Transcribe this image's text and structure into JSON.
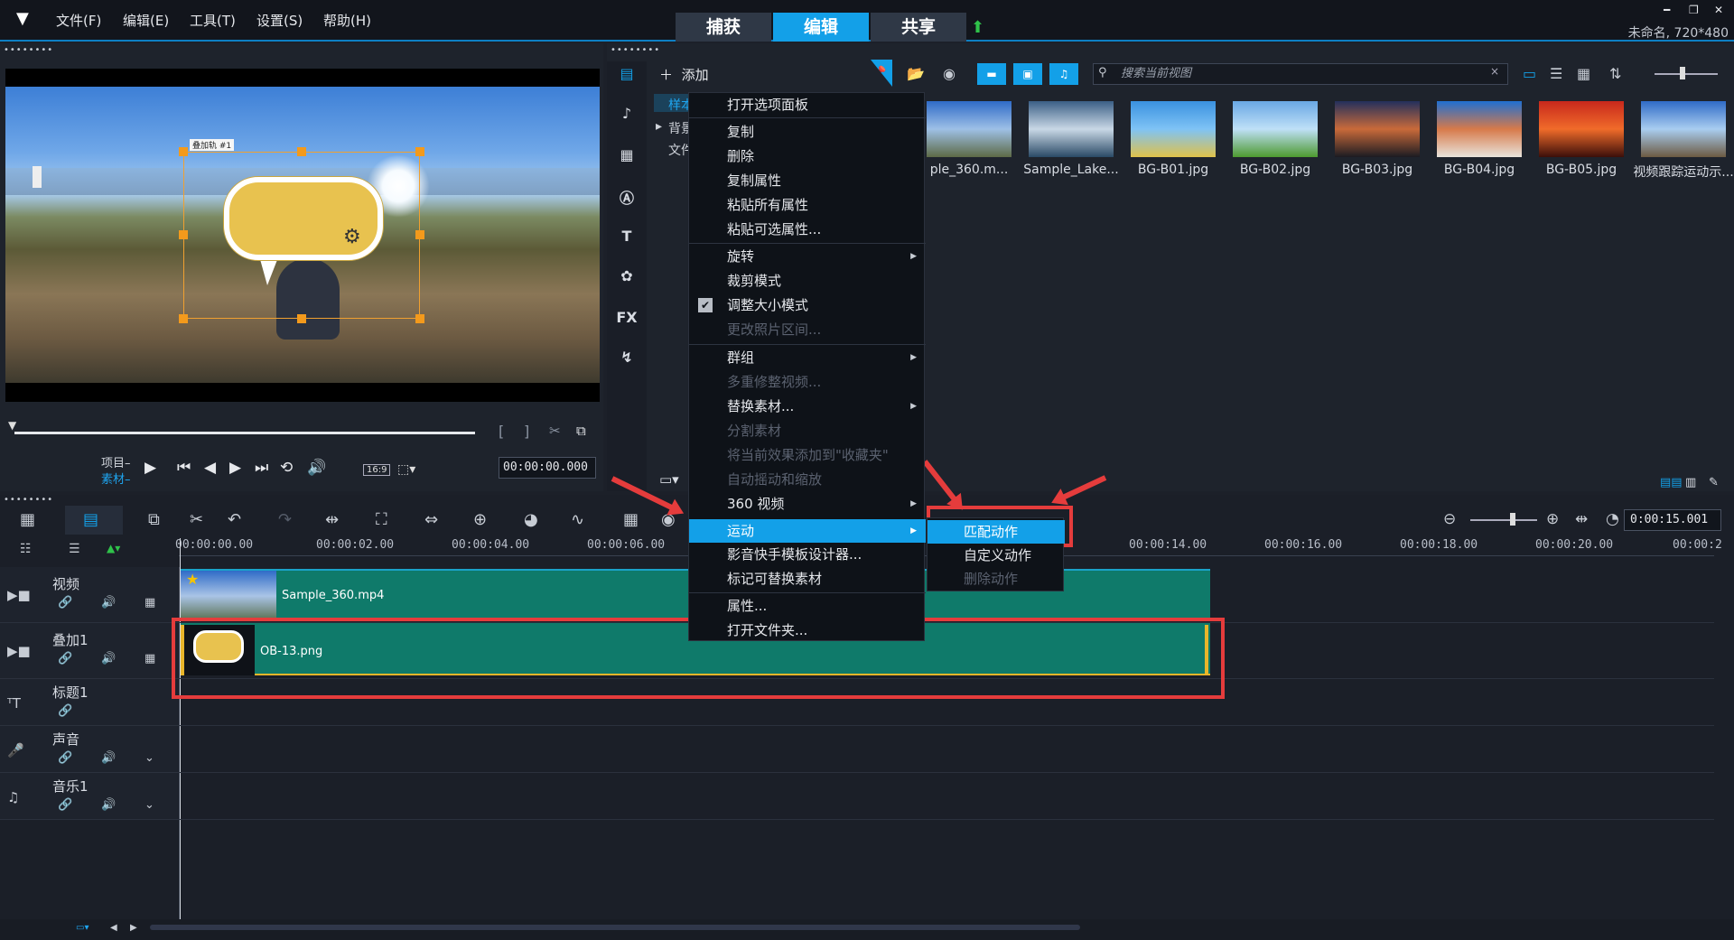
{
  "menubar": {
    "items": [
      "文件(F)",
      "编辑(E)",
      "工具(T)",
      "设置(S)",
      "帮助(H)"
    ]
  },
  "modes": {
    "capture": "捕获",
    "edit": "编辑",
    "share": "共享"
  },
  "window": {
    "project_info": "未命名, 720*480"
  },
  "preview": {
    "selection_label": "叠加轨 #1",
    "project_label": "项目–",
    "clip_label": "素材–",
    "aspect_label": "16:9",
    "timecode": "00:00:00.000"
  },
  "library": {
    "add_label": "添加",
    "search_placeholder": "搜索当前视图",
    "search_clear": "×",
    "tree": [
      "样本",
      "背景",
      "文件夹"
    ],
    "thumbnails": [
      {
        "name": "ple_360.m...",
        "colors": [
          "#2f6bc7",
          "#9ec0e6",
          "#5d6a46"
        ]
      },
      {
        "name": "Sample_Lake...",
        "colors": [
          "#3b5f86",
          "#c9d8e6",
          "#2a4a66"
        ]
      },
      {
        "name": "BG-B01.jpg",
        "colors": [
          "#3a91e0",
          "#7fc3f5",
          "#e0c24a"
        ]
      },
      {
        "name": "BG-B02.jpg",
        "colors": [
          "#69a7e4",
          "#bfe0f7",
          "#4d9a2f"
        ]
      },
      {
        "name": "BG-B03.jpg",
        "colors": [
          "#23305c",
          "#c96a3a",
          "#1b1b22"
        ]
      },
      {
        "name": "BG-B04.jpg",
        "colors": [
          "#1f6fd1",
          "#d77a4a",
          "#e8e4dc"
        ]
      },
      {
        "name": "BG-B05.jpg",
        "colors": [
          "#c8281c",
          "#f06b2a",
          "#3b0e0a"
        ]
      },
      {
        "name": "视频跟踪运动示...",
        "colors": [
          "#2f6bc7",
          "#a9cdf0",
          "#6c5a42"
        ]
      }
    ]
  },
  "context_menu": {
    "items": [
      {
        "label": "打开选项面板",
        "disabled": false
      },
      {
        "label": "复制",
        "disabled": false
      },
      {
        "label": "删除",
        "disabled": false
      },
      {
        "label": "复制属性",
        "disabled": false
      },
      {
        "label": "粘贴所有属性",
        "disabled": false
      },
      {
        "label": "粘贴可选属性...",
        "disabled": false
      },
      {
        "label": "旋转",
        "disabled": false,
        "submenu": true
      },
      {
        "label": "裁剪模式",
        "disabled": false
      },
      {
        "label": "调整大小模式",
        "disabled": false,
        "checked": true
      },
      {
        "label": "更改照片区间...",
        "disabled": true
      },
      {
        "label": "群组",
        "disabled": false,
        "submenu": true
      },
      {
        "label": "多重修整视频...",
        "disabled": true
      },
      {
        "label": "替换素材...",
        "disabled": false,
        "submenu": true
      },
      {
        "label": "分割素材",
        "disabled": true
      },
      {
        "label": "将当前效果添加到\"收藏夹\"",
        "disabled": true
      },
      {
        "label": "自动摇动和缩放",
        "disabled": true
      },
      {
        "label": "360 视频",
        "disabled": false,
        "submenu": true
      },
      {
        "label": "运动",
        "disabled": false,
        "submenu": true,
        "highlighted": true
      },
      {
        "label": "影音快手模板设计器...",
        "disabled": false
      },
      {
        "label": "标记可替换素材",
        "disabled": false
      },
      {
        "label": "属性...",
        "disabled": false
      },
      {
        "label": "打开文件夹...",
        "disabled": false
      }
    ],
    "submenu_motion": [
      {
        "label": "匹配动作",
        "highlighted": true,
        "disabled": false
      },
      {
        "label": "自定义动作",
        "disabled": false
      },
      {
        "label": "删除动作",
        "disabled": true
      }
    ]
  },
  "timeline": {
    "timecode": "0:00:15.001",
    "ticks": [
      "00:00:00.00",
      "00:00:02.00",
      "00:00:04.00",
      "00:00:06.00",
      "00:00:14.00",
      "00:00:16.00",
      "00:00:18.00",
      "00:00:20.00",
      "00:00:2"
    ],
    "tracks": [
      {
        "name": "视频"
      },
      {
        "name": "叠加1"
      },
      {
        "name": "标题1"
      },
      {
        "name": "声音"
      },
      {
        "name": "音乐1"
      }
    ],
    "video_clip": "Sample_360.mp4",
    "overlay_clip": "OB-13.png"
  },
  "colors": {
    "accent": "#13a0e8",
    "annotation": "#e53c3c",
    "clip": "#0f7a6a"
  }
}
